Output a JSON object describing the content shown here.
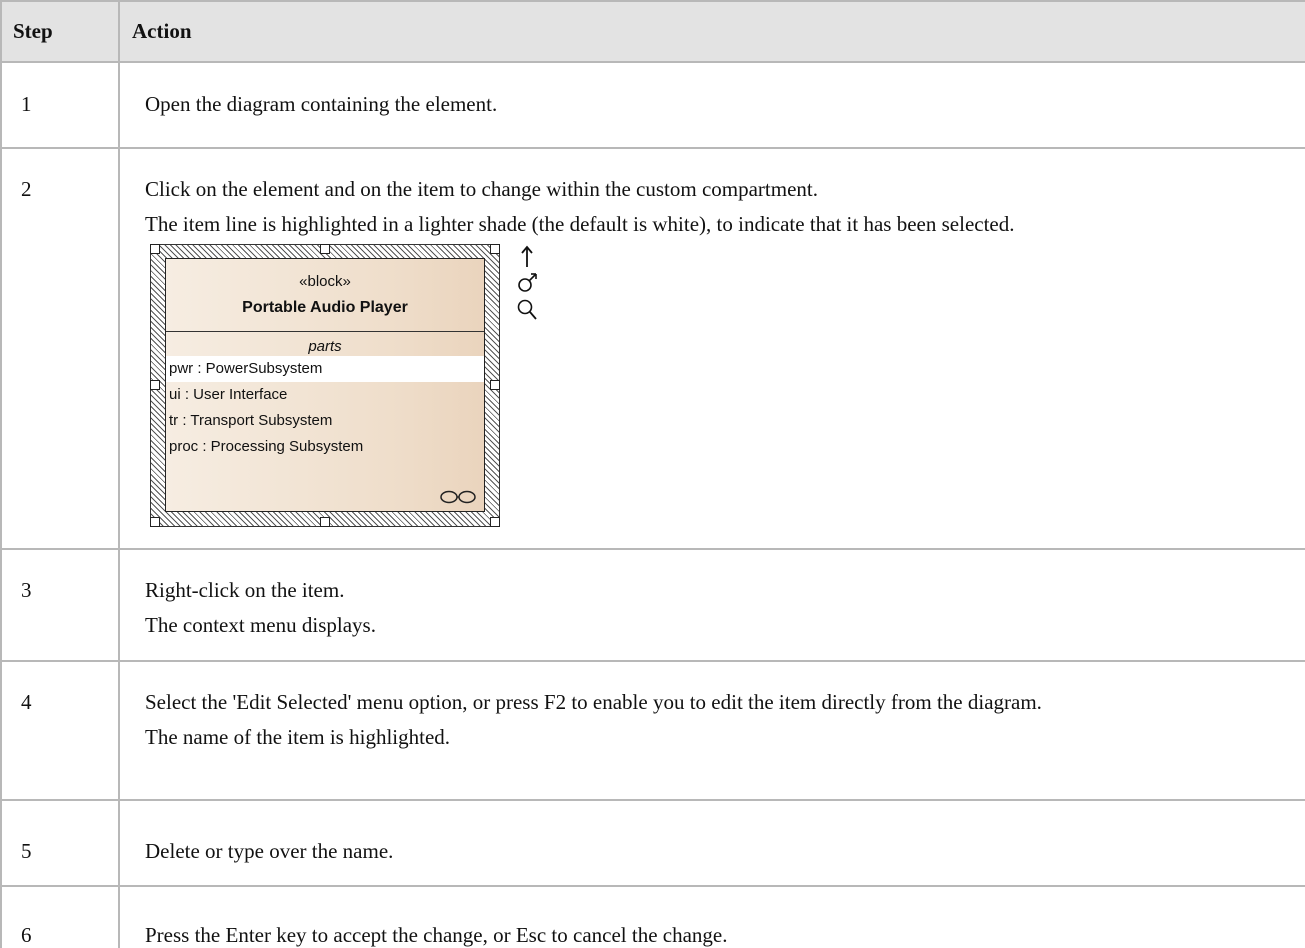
{
  "table": {
    "headers": {
      "step": "Step",
      "action": "Action"
    },
    "rows": [
      {
        "step": "1",
        "lines": [
          "Open the diagram containing the element."
        ]
      },
      {
        "step": "2",
        "lines": [
          "Click on the element and on the item to change within the custom compartment.",
          "The item line is highlighted in a lighter shade (the default is white), to indicate that it has been selected."
        ]
      },
      {
        "step": "3",
        "lines": [
          "Right-click on the item.",
          "The context menu displays."
        ]
      },
      {
        "step": "4",
        "lines": [
          "Select the 'Edit Selected' menu option, or press F2 to enable you to edit the item directly from the diagram.",
          "The name of the item is highlighted."
        ]
      },
      {
        "step": "5",
        "lines": [
          "Delete or type over the name."
        ]
      },
      {
        "step": "6",
        "lines": [
          "Press the Enter key to accept the change, or Esc to cancel the change."
        ]
      }
    ]
  },
  "diagram": {
    "stereotype": "«block»",
    "name": "Portable Audio Player",
    "compartment_title": "parts",
    "parts": [
      "pwr : PowerSubsystem",
      "ui : User Interface",
      "tr : Transport Subsystem",
      "proc : Processing Subsystem"
    ],
    "selected_part_index": 0,
    "colors": {
      "fill_light": "#f6ede2",
      "fill_dark": "#ead4bd",
      "selection": "#ffffff"
    },
    "side_icons": [
      "up-arrow-icon",
      "quick-link-icon",
      "zoom-icon"
    ]
  }
}
